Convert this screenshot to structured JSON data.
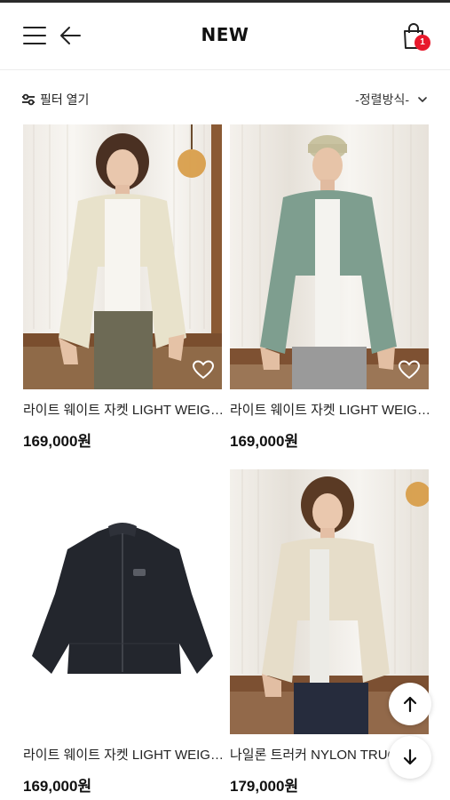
{
  "header": {
    "title": "NEW",
    "cart_count": "1",
    "icons": {
      "menu": "hamburger-menu-icon",
      "back": "arrow-left-icon",
      "cart": "shopping-bag-icon"
    }
  },
  "filter": {
    "open_label": "필터 열기",
    "sort_label": "-정렬방식-",
    "icons": {
      "filter": "sliders-icon",
      "sort": "chevron-down-icon"
    }
  },
  "products": [
    {
      "name": "라이트 웨이트 자켓 LIGHT WEIGHT JACKET",
      "price": "169,000원",
      "color": "ivory",
      "wishlist_icon": "heart-outline-icon"
    },
    {
      "name": "라이트 웨이트 자켓 LIGHT WEIGHT JACKET",
      "price": "169,000원",
      "color": "sage green",
      "wishlist_icon": "heart-outline-icon"
    },
    {
      "name": "라이트 웨이트 자켓 LIGHT WEIGHT JACKET",
      "price": "169,000원",
      "color": "black",
      "wishlist_icon": "heart-outline-icon"
    },
    {
      "name": "나일론 트러커 NYLON TRUCKER JACKET",
      "price": "179,000원",
      "color": "beige",
      "wishlist_icon": "heart-outline-icon"
    }
  ],
  "floating": {
    "scroll_top_icon": "arrow-up-icon",
    "scroll_bottom_icon": "arrow-down-icon"
  },
  "colors": {
    "badge": "#e8192c",
    "text": "#111111",
    "background": "#ffffff"
  }
}
